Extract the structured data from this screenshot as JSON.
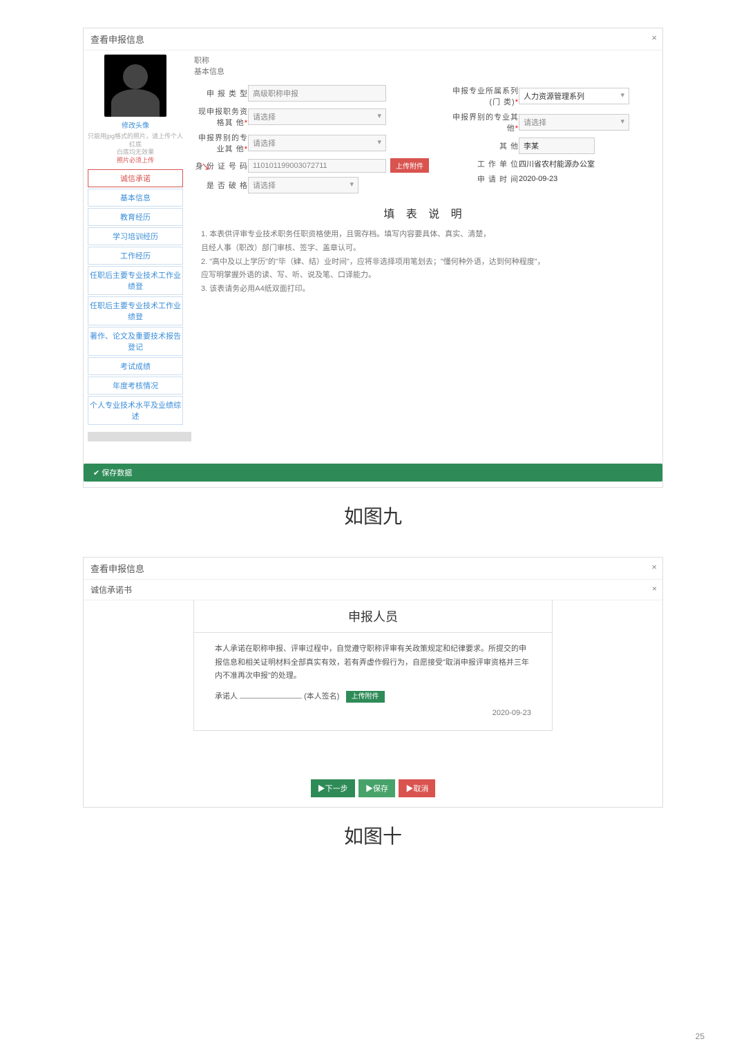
{
  "pagenum": "25",
  "modal1": {
    "title": "查看申报信息",
    "close": "×",
    "sidebar": {
      "change": "修改头像",
      "hint1": "只能用jpg格式的照片，请上传个人红底",
      "hint2": "白底均无效果",
      "hint3": "照片必须上传",
      "nav": [
        "诚信承诺",
        "基本信息",
        "教育经历",
        "学习培训经历",
        "工作经历",
        "任职后主要专业技术工作业绩登",
        "任职后主要专业技术工作业绩登",
        "著作、论文及重要技术报告登记",
        "考试成绩",
        "年度考核情况",
        "个人专业技术水平及业绩综述"
      ]
    },
    "tabs": {
      "t1": "职称",
      "t2": "基本信息"
    },
    "labels": {
      "l1": "申 报 类 型",
      "l2": "现申报职务资格其  他",
      "l3": "申报界别的专业其  他",
      "l4": "身 份 证 号 码",
      "l5": "是 否 破 格",
      "r1": "申报专业所属系列(门  类)",
      "r2": "申报界别的专业其  他",
      "r3": "其  他",
      "r4": "工 作 单 位",
      "r5": "申 请 时 间"
    },
    "values": {
      "v1": "高级职称申报",
      "v2": "请选择",
      "v3": "请选择",
      "v4": "110101199003072711",
      "v5": "请选择",
      "rv1": "人力资源管理系列",
      "rv2": "请选择",
      "rv3": "李某",
      "rv4": "四川省农村能源办公室",
      "rv5": "2020-09-23"
    },
    "upload_btn": "上传附件",
    "instr_title": "填 表 说 明",
    "instr_lines": [
      "1. 本表供评审专业技术职务任职资格使用，且需存档。填写内容要具体、真实、清楚，",
      "且经人事（职改）部门审核、签字、盖章认可。",
      "2. \"高中及以上学历\"的\"毕（肄、结）业时间\"，应将非选择项用笔划去；\"懂何种外语，达到何种程度\"，",
      "应写明掌握外语的读、写、听、说及笔、口译能力。",
      "3. 该表请务必用A4纸双面打印。"
    ],
    "save": "保存数据"
  },
  "caption1": "如图九",
  "modal2": {
    "title": "查看申报信息",
    "sub": "诚信承诺书",
    "close": "×",
    "head": "申报人员",
    "body": "本人承诺在职称申报、评审过程中，自觉遵守职称评审有关政策规定和纪律要求。所提交的申报信息和相关证明材料全部真实有效，若有弄虚作假行为，自愿接受\"取消申报评审资格并三年内不准再次申报\"的处理。",
    "sig_label": "承诺人",
    "sig_paren": "(本人签名)",
    "sig_btn": "上传附件",
    "date": "2020-09-23",
    "b1": "下一步",
    "b2": "保存",
    "b3": "取消"
  },
  "caption2": "如图十"
}
